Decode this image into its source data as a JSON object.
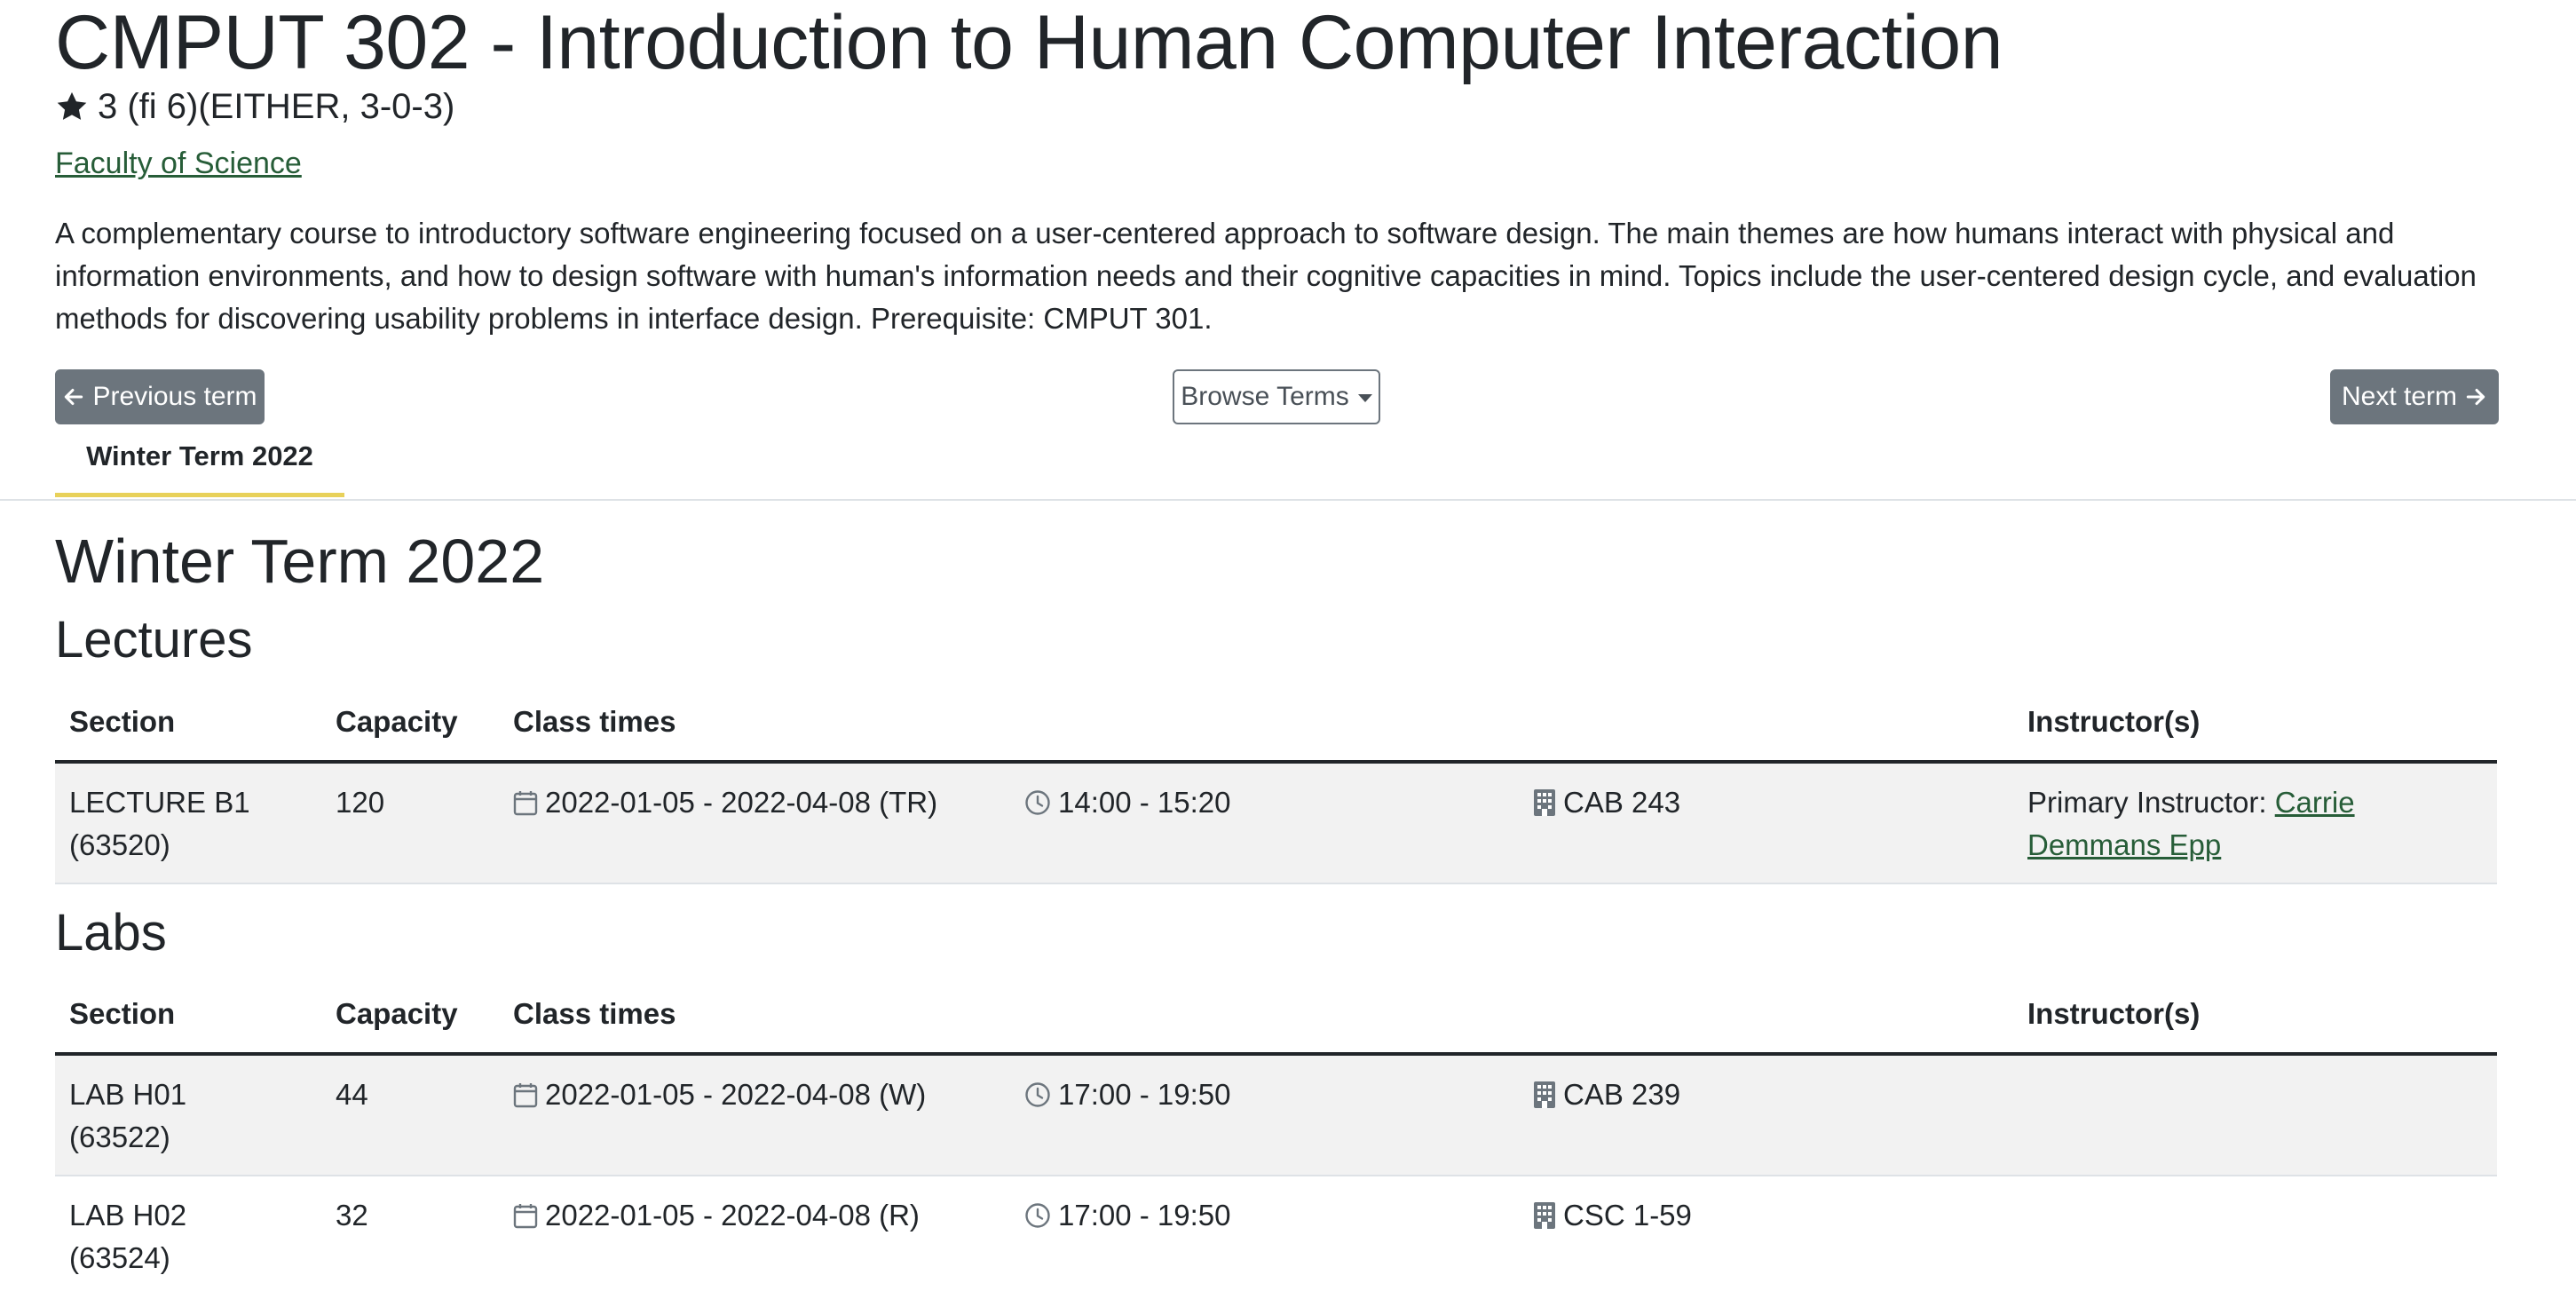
{
  "course": {
    "title": "CMPUT 302 - Introduction to Human Computer Interaction",
    "credits": "3 (fi 6)(EITHER, 3-0-3)",
    "faculty": "Faculty of Science",
    "description": "A complementary course to introductory software engineering focused on a user-centered approach to software design. The main themes are how humans interact with physical and information environments, and how to design software with human's information needs and their cognitive capacities in mind. Topics include the user-centered design cycle, and evaluation methods for discovering usability problems in interface design. Prerequisite: CMPUT 301."
  },
  "nav": {
    "previous": "Previous term",
    "browse": "Browse Terms",
    "next": "Next term"
  },
  "tab": {
    "active": "Winter Term 2022"
  },
  "term": {
    "heading": "Winter Term 2022"
  },
  "columns": {
    "section": "Section",
    "capacity": "Capacity",
    "class_times": "Class times",
    "instructors": "Instructor(s)"
  },
  "lectures": {
    "heading": "Lectures",
    "rows": [
      {
        "section": "LECTURE B1",
        "section_id": "(63520)",
        "capacity": "120",
        "dates": "2022-01-05 - 2022-04-08 (TR)",
        "time": "14:00 - 15:20",
        "room": "CAB 243",
        "instructor_label": "Primary Instructor: ",
        "instructor_name": "Carrie Demmans Epp"
      }
    ]
  },
  "labs": {
    "heading": "Labs",
    "rows": [
      {
        "section": "LAB H01",
        "section_id": "(63522)",
        "capacity": "44",
        "dates": "2022-01-05 - 2022-04-08 (W)",
        "time": "17:00 - 19:50",
        "room": "CAB 239"
      },
      {
        "section": "LAB H02",
        "section_id": "(63524)",
        "capacity": "32",
        "dates": "2022-01-05 - 2022-04-08 (R)",
        "time": "17:00 - 19:50",
        "room": "CSC 1-59"
      }
    ]
  },
  "colors": {
    "link": "#275d38",
    "button": "#6c757d",
    "tab_underline": "#e8d15a",
    "row_shade": "#f2f2f2"
  },
  "icons": {
    "credits": "star-icon",
    "previous": "arrow-left-icon",
    "next": "arrow-right-icon",
    "browse": "caret-down-icon",
    "dates": "calendar-icon",
    "time": "clock-icon",
    "room": "building-icon"
  }
}
